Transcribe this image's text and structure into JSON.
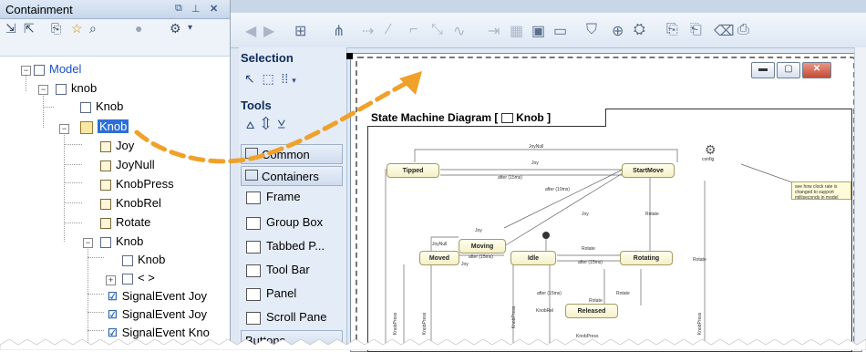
{
  "containment": {
    "title": "Containment",
    "toolbar_icons": [
      "expand-all-icon",
      "collapse-all-icon",
      "open-icon",
      "favorite-icon",
      "search-icon",
      "filter-icon",
      "settings-icon"
    ],
    "tree": [
      {
        "label": "Model",
        "icon": "model-icon",
        "depth": 0,
        "expander": "−"
      },
      {
        "label": "knob",
        "icon": "package-icon",
        "depth": 1,
        "expander": "−"
      },
      {
        "label": "Knob",
        "icon": "diagram-icon",
        "depth": 2
      },
      {
        "label": "Knob",
        "icon": "state-machine-icon",
        "depth": 2,
        "expander": "−",
        "selected": true
      },
      {
        "label": "Joy",
        "icon": "signal-icon",
        "depth": 3
      },
      {
        "label": "JoyNull",
        "icon": "signal-icon",
        "depth": 3
      },
      {
        "label": "KnobPress",
        "icon": "signal-icon",
        "depth": 3
      },
      {
        "label": "KnobRel",
        "icon": "signal-icon",
        "depth": 3
      },
      {
        "label": "Rotate",
        "icon": "signal-icon",
        "depth": 3
      },
      {
        "label": "Knob",
        "icon": "region-icon",
        "depth": 3,
        "expander": "−"
      },
      {
        "label": "Knob",
        "icon": "diagram-icon",
        "depth": 4
      },
      {
        "label": "< >",
        "icon": "region-icon",
        "depth": 4,
        "expander": "+"
      },
      {
        "label": "SignalEvent Joy",
        "icon": "event-icon",
        "depth": 4
      },
      {
        "label": "SignalEvent Joy",
        "icon": "event-icon",
        "depth": 4
      },
      {
        "label": "SignalEvent Kno",
        "icon": "event-icon",
        "depth": 4
      }
    ]
  },
  "palette": {
    "selection_header": "Selection",
    "tools_header": "Tools",
    "groups": [
      {
        "label": "Common"
      },
      {
        "label": "Containers"
      }
    ],
    "items": [
      {
        "label": "Frame"
      },
      {
        "label": "Group Box"
      },
      {
        "label": "Tabbed P..."
      },
      {
        "label": "Tool Bar"
      },
      {
        "label": "Panel"
      },
      {
        "label": "Scroll Pane"
      }
    ],
    "buttons_group": "Buttons"
  },
  "diagram": {
    "frame_label": "State Machine Diagram",
    "frame_element": "Knob",
    "states": [
      {
        "name": "Tipped"
      },
      {
        "name": "StartMove"
      },
      {
        "name": "Moving"
      },
      {
        "name": "Moved"
      },
      {
        "name": "Idle"
      },
      {
        "name": "Rotating"
      },
      {
        "name": "Released"
      }
    ],
    "transitions": [
      {
        "label": "JoyNull"
      },
      {
        "label": "Joy"
      },
      {
        "label": "after (15ms)"
      },
      {
        "label": "after (10ms)"
      },
      {
        "label": "Joy"
      },
      {
        "label": "JoyNull"
      },
      {
        "label": "Joy"
      },
      {
        "label": "Joy"
      },
      {
        "label": "Rotate"
      },
      {
        "label": "after (15ms)"
      },
      {
        "label": "Rotate"
      },
      {
        "label": "after (15ms)"
      },
      {
        "label": "Rotate"
      },
      {
        "label": "Rotate"
      },
      {
        "label": "after (15ms)"
      },
      {
        "label": "Rotate"
      },
      {
        "label": "KnobRel"
      },
      {
        "label": "KnobPress"
      },
      {
        "label": "KnobPress"
      },
      {
        "label": "KnobPress"
      },
      {
        "label": "KnobPress"
      },
      {
        "label": "KnobPress"
      }
    ],
    "config_label": "config",
    "note_text": "see how clock rate is changed to support milliseconds in model"
  },
  "colors": {
    "arrow": "#f0a129",
    "selection": "#2d6fd6",
    "state_fill": "#f6f2cb"
  }
}
